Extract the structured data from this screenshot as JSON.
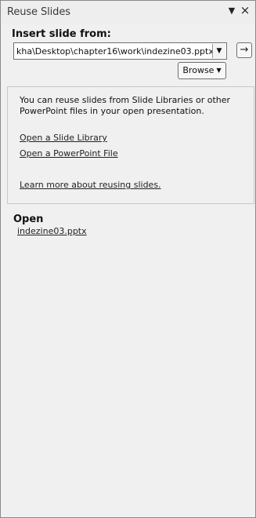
{
  "pane": {
    "title": "Reuse Slides",
    "dropdown_icon": "▼",
    "close_icon": "×"
  },
  "insert": {
    "label": "Insert slide from:",
    "path_value": "kha\\Desktop\\chapter16\\work\\indezine03.pptx",
    "combo_arrow": "▼",
    "go_icon": "→",
    "browse_label": "Browse",
    "browse_arrow": "▼"
  },
  "info": {
    "text": "You can reuse slides from Slide Libraries or other PowerPoint files in your open presentation.",
    "links": [
      "Open a Slide Library",
      "Open a PowerPoint File",
      "Learn more about reusing slides."
    ]
  },
  "open": {
    "label": "Open",
    "files": [
      "indezine03.pptx"
    ]
  }
}
